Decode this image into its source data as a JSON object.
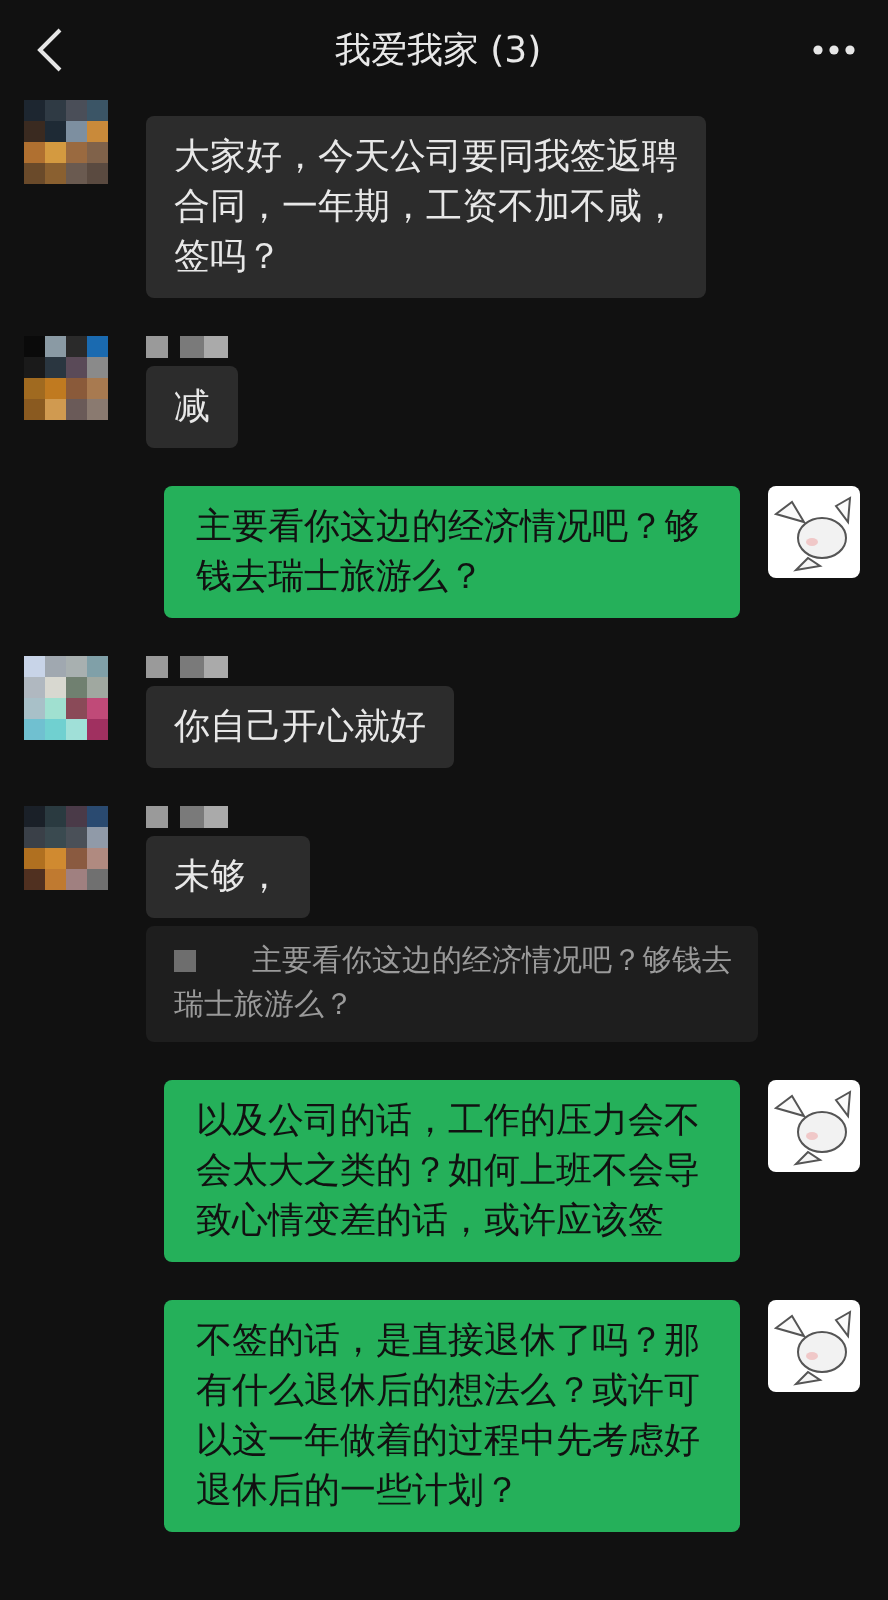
{
  "header": {
    "title": "我爱我家 (3)"
  },
  "messages": [
    {
      "kind": "incoming",
      "name_shown": false,
      "text": "大家好，今天公司要同我签返聘合同，一年期，工资不加不咸，签吗？"
    },
    {
      "kind": "incoming",
      "name_shown": true,
      "text": "减"
    },
    {
      "kind": "outgoing",
      "text": "主要看你这边的经济情况吧？够钱去瑞士旅游么？"
    },
    {
      "kind": "incoming",
      "name_shown": true,
      "text": "你自己开心就好"
    },
    {
      "kind": "incoming",
      "name_shown": true,
      "text": "未够，",
      "quote": {
        "text": "主要看你这边的经济情况吧？够钱去瑞士旅游么？"
      }
    },
    {
      "kind": "outgoing",
      "text": "以及公司的话，工作的压力会不会太大之类的？如何上班不会导致心情变差的话，或许应该签"
    },
    {
      "kind": "outgoing",
      "text": "不签的话，是直接退休了吗？那有什么退休后的想法么？或许可以这一年做着的过程中先考虑好退休后的一些计划？"
    }
  ]
}
